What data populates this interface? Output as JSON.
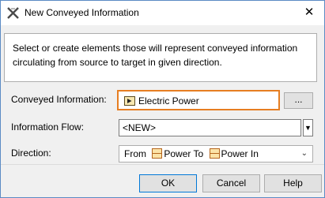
{
  "window": {
    "title": "New Conveyed Information",
    "icon": "magicdraw-x-icon",
    "close_glyph": "✕"
  },
  "description": "Select or create elements those will represent conveyed information circulating from source to target in given direction.",
  "form": {
    "conveyed_information": {
      "label": "Conveyed Information:",
      "value": "Electric Power",
      "icon": "signal-element-icon",
      "browse_label": "..."
    },
    "information_flow": {
      "label": "Information Flow:",
      "value": "<NEW>",
      "dropdown_glyph": "▼"
    },
    "direction": {
      "label": "Direction:",
      "from_text": "From",
      "from_port": "Power",
      "to_text": "To",
      "to_port": "Power In",
      "port_icon": "port-icon",
      "dropdown_glyph": "⌄"
    }
  },
  "buttons": {
    "ok": "OK",
    "cancel": "Cancel",
    "help": "Help"
  },
  "colors": {
    "highlight_border": "#e67e22",
    "title_bar": "#ffffff",
    "dialog_bg": "#f0f0f0"
  }
}
